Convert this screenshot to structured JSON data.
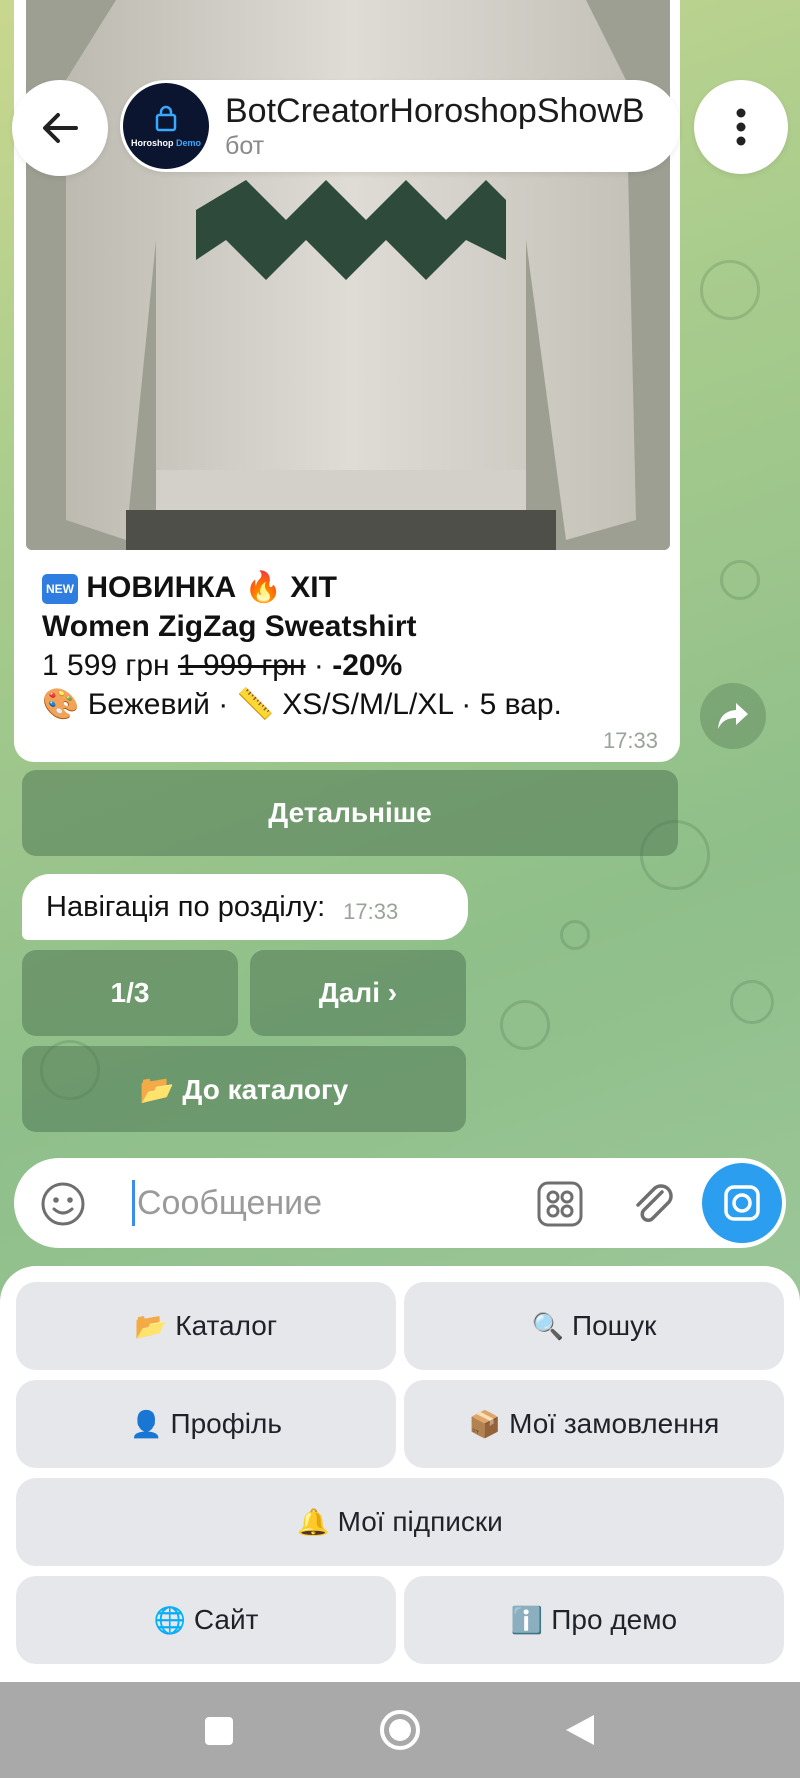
{
  "header": {
    "title": "BotCreatorHoroshopShowB",
    "subtitle": "бот",
    "avatar_text_a": "Horoshop",
    "avatar_text_b": "Demo"
  },
  "product": {
    "badge_new": "NEW",
    "tag_line": "НОВИНКА 🔥 ХІТ",
    "name": "Women ZigZag Sweatshirt",
    "price": "1 599 грн",
    "old_price": "1 999 грн",
    "separator": "·",
    "discount": "-20%",
    "details": "🎨 Бежевий · 📏 XS/S/M/L/XL · 5 вар.",
    "time": "17:33"
  },
  "inline_keyboard": {
    "details_button": "Детальніше"
  },
  "navigation": {
    "text": "Навігація по розділу:",
    "time": "17:33",
    "page_button": "1/3",
    "next_button": "Далі ›",
    "catalog_button": "📂 До каталогу"
  },
  "input": {
    "placeholder": "Сообщение"
  },
  "reply_keyboard": {
    "catalog": {
      "emoji": "📂",
      "label": "Каталог"
    },
    "search": {
      "emoji": "🔍",
      "label": "Пошук"
    },
    "profile": {
      "emoji": "👤",
      "label": "Профіль"
    },
    "orders": {
      "emoji": "📦",
      "label": "Мої замовлення"
    },
    "subscriptions": {
      "emoji": "🔔",
      "label": "Мої підписки"
    },
    "site": {
      "emoji": "🌐",
      "label": "Сайт"
    },
    "about": {
      "emoji": "ℹ️",
      "label": "Про демо"
    }
  },
  "colors": {
    "accent": "#2b9ef0",
    "inline_button": "#5b8a5f",
    "keyboard_button": "#e5e7eb"
  }
}
